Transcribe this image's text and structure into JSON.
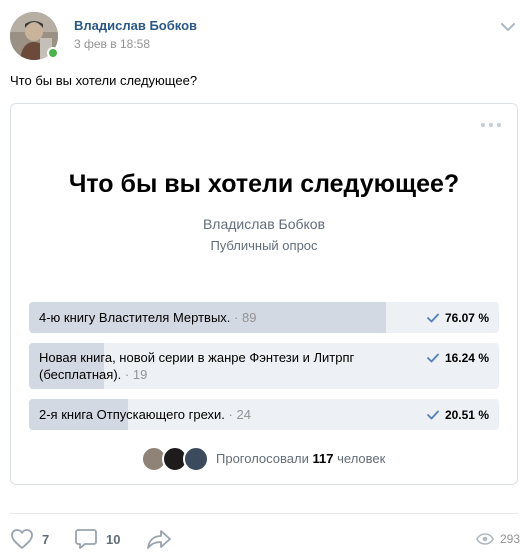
{
  "post": {
    "author": "Владислав Бобков",
    "date": "3 фев в 18:58",
    "text": "Что бы вы хотели следующее?"
  },
  "poll": {
    "title": "Что бы вы хотели следующее?",
    "owner": "Владислав Бобков",
    "kind": "Публичный опрос",
    "answers": [
      {
        "text": "4-ю книгу Властителя Мертвых.",
        "count": "· 89",
        "percent": "76.07 %",
        "fill": 0.76
      },
      {
        "text": "Новая книга, новой серии в жанре Фэнтези и Литрпг",
        "text2": "(бесплатная).",
        "count": "· 19",
        "percent": "16.24 %",
        "fill": 0.16
      },
      {
        "text": "2-я книга Отпускающего грехи.",
        "count": "· 24",
        "percent": "20.51 %",
        "fill": 0.21
      }
    ],
    "voters_prefix": "Проголосовали",
    "voters_count": "117",
    "voters_suffix": "человек"
  },
  "actions": {
    "likes": "7",
    "comments": "10",
    "views": "293"
  },
  "icons": {
    "chevron": "chevron-down-icon",
    "more": "more-icon",
    "check": "check-icon",
    "like": "heart-icon",
    "comment": "comment-icon",
    "share": "share-icon",
    "views": "eye-icon"
  },
  "colors": {
    "link": "#2a5885",
    "muted": "#939393",
    "secondary": "#626d7a",
    "accent": "#5181b8",
    "answer_bg": "#edf0f5",
    "answer_fill": "#d3d9e2",
    "online": "#4bb34b"
  }
}
